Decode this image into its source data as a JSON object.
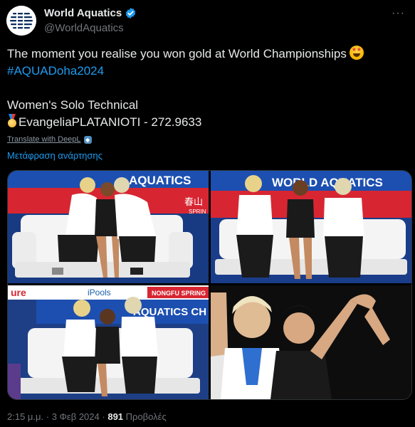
{
  "account": {
    "display_name": "World Aquatics",
    "handle": "@WorldAquatics",
    "verified": true,
    "verified_color": "#1d9bf0",
    "avatar_icon": "world-aquatics-logo"
  },
  "menu": {
    "more_label": "···"
  },
  "tweet": {
    "line1": "The moment you realise you won gold at World Championships",
    "line1_emoji": "star-struck-emoji",
    "hashtag": "#AQUADoha2024",
    "line3": "Women's Solo Technical",
    "line4_emoji": "gold-medal-emoji",
    "line4": "EvangeliaPLATANIOTI - 272.9633"
  },
  "translate": {
    "deepl_label": "Translate with DeepL",
    "post_label": "Μετάφραση ανάρτησης"
  },
  "media": {
    "photo1": {
      "banner_text": "AQUATICS",
      "banner_sub": "春山",
      "banner_sub2": "SPRIN"
    },
    "photo2": {
      "banner_text": "WORLD AQUATICS"
    },
    "photo3": {
      "banner_text": "AQUATICS CH",
      "banner_top": "iPools",
      "banner_top2": "NONGFU SPRING",
      "banner_left": "ure"
    },
    "photo4": {}
  },
  "footer": {
    "time": "2:15 μ.μ.",
    "sep1": "·",
    "date": "3 Φεβ 2024",
    "sep2": "·",
    "views_count": "891",
    "views_label": "Προβολές"
  },
  "colors": {
    "background": "#000000",
    "text": "#e7e9ea",
    "muted": "#71767b",
    "link": "#1d9bf0"
  }
}
